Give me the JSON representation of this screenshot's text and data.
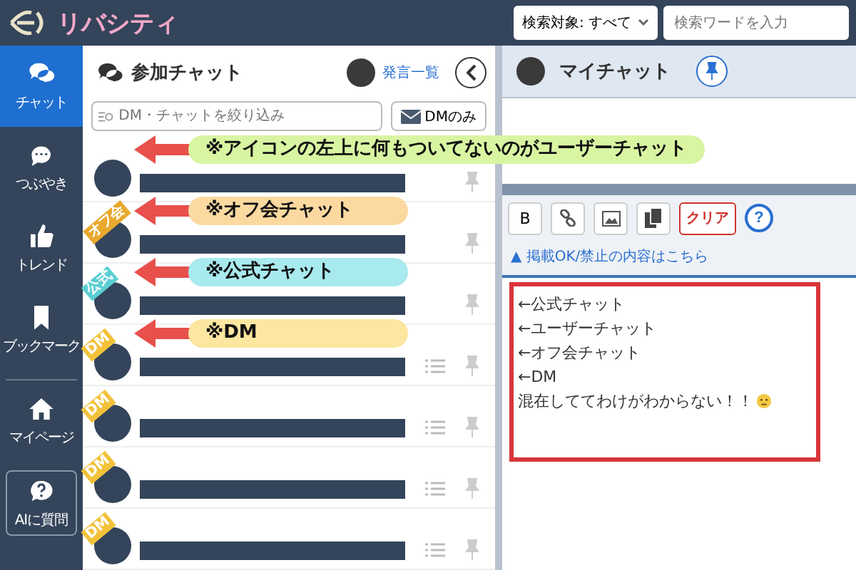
{
  "logo": {
    "text": "リバシティ"
  },
  "search": {
    "target": "検索対象: すべて",
    "placeholder": "検索ワードを入力"
  },
  "sidebar": {
    "items": [
      {
        "label": "チャット",
        "selected": true
      },
      {
        "label": "つぶやき",
        "selected": false
      },
      {
        "label": "トレンド",
        "selected": false
      },
      {
        "label": "ブックマーク",
        "selected": false
      },
      {
        "label": "マイページ",
        "selected": false
      },
      {
        "label": "AIに質問",
        "selected": false
      }
    ]
  },
  "chat_list": {
    "title": "参加チャット",
    "history_link": "発言一覧",
    "filter_placeholder": "DM・チャットを絞り込み",
    "dm_button": "DMのみ",
    "rows": [
      {
        "kind": "user",
        "list_icon": false
      },
      {
        "kind": "offkai",
        "tag": "オフ会",
        "list_icon": false
      },
      {
        "kind": "official",
        "tag": "公式",
        "list_icon": false
      },
      {
        "kind": "dm",
        "tag": "DM",
        "list_icon": true
      },
      {
        "kind": "dm",
        "tag": "DM",
        "list_icon": true
      },
      {
        "kind": "dm",
        "tag": "DM",
        "list_icon": true
      },
      {
        "kind": "dm",
        "tag": "DM",
        "list_icon": true
      }
    ]
  },
  "callouts": [
    {
      "text": "※アイコンの左上に何もついてないのがユーザーチャット",
      "color": "#d8f5a2"
    },
    {
      "text": "※オフ会チャット",
      "color": "#fbd9a0"
    },
    {
      "text": "※公式チャット",
      "color": "#a8eaee"
    },
    {
      "text": "※DM",
      "color": "#fde6a0"
    }
  ],
  "my_chat": {
    "title": "マイチャット",
    "toolbar": {
      "bold": "B",
      "clear": "クリア",
      "help": "?"
    },
    "notice": "▲ 掲載OK/禁止の内容はこちら",
    "lines": [
      "←公式チャット",
      "←ユーザーチャット",
      "←オフ会チャット",
      "←DM",
      "混在しててわけがわからない！！"
    ]
  }
}
